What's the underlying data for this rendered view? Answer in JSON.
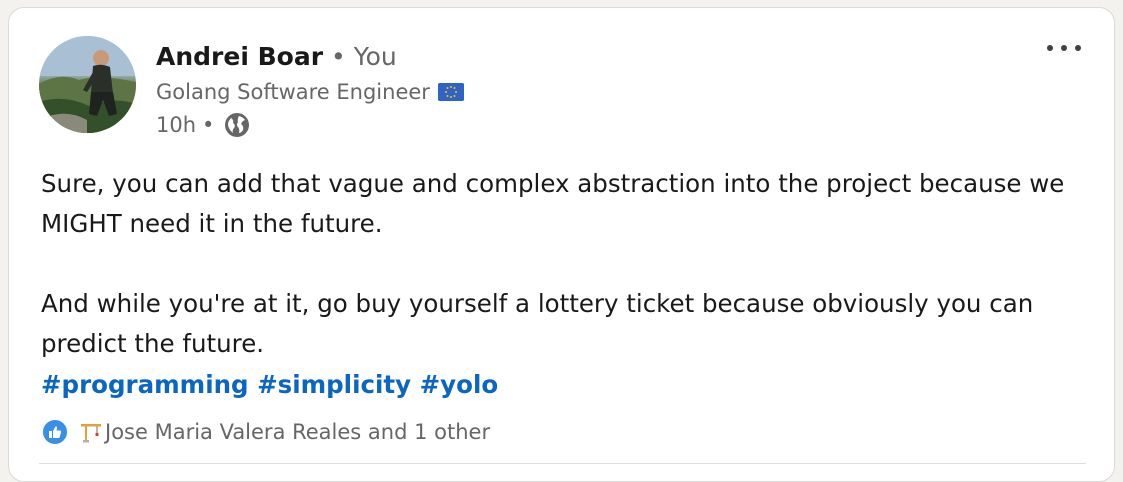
{
  "post": {
    "author": {
      "name": "Andrei Boar",
      "separator": "•",
      "relation": "You",
      "headline": "Golang Software Engineer",
      "headline_badge_icon": "eu-flag-icon",
      "time": "10h",
      "time_separator": "•",
      "visibility_icon": "globe-icon"
    },
    "menu_icon": "more-options-icon",
    "body": {
      "line1": "Sure, you can add that vague and complex abstraction into the project because we MIGHT need it in the future.",
      "line2": "And while you're at it, go buy yourself a lottery ticket because obviously you can predict the future."
    },
    "hashtags": [
      "#programming",
      "#simplicity",
      "#yolo"
    ],
    "reactions": {
      "icon": "like-reaction-icon",
      "reactor_badge_icon": "construction-crane-icon",
      "summary": "Jose Maria Valera Reales and 1 other"
    }
  },
  "colors": {
    "link": "#0a66c2",
    "secondary_text": "#666666",
    "like": "#378fe9",
    "page_bg": "#f4f2ee"
  }
}
